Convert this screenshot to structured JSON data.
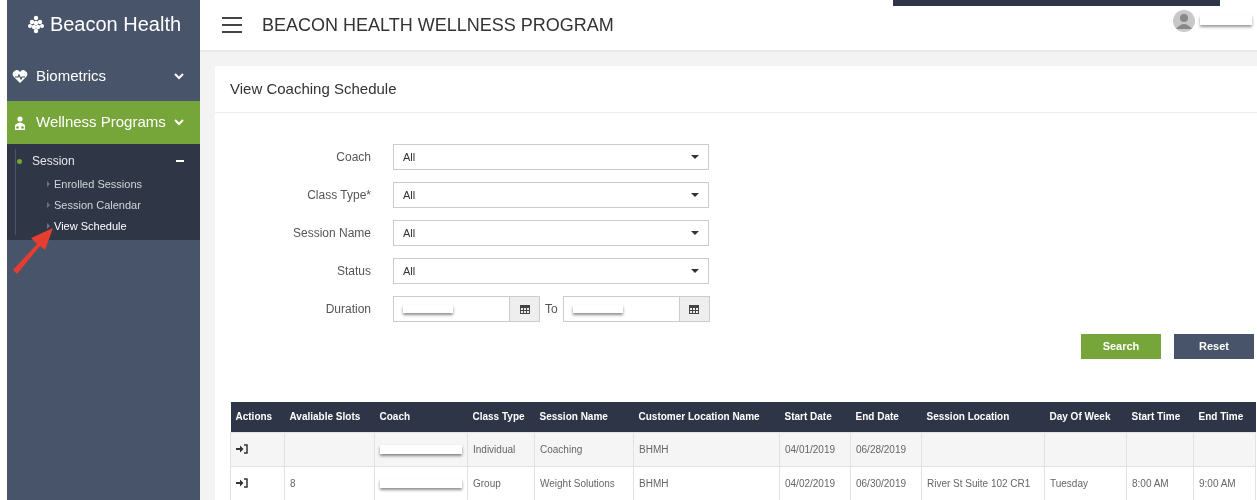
{
  "brand": {
    "name": "Beacon Health"
  },
  "sidebar": {
    "items": [
      {
        "label": "Biometrics",
        "selected": false
      },
      {
        "label": "Wellness Programs",
        "selected": true,
        "children": [
          {
            "label": "Session",
            "expanded": true,
            "children": [
              {
                "label": "Enrolled Sessions",
                "selected": false
              },
              {
                "label": "Session Calendar",
                "selected": false
              },
              {
                "label": "View Schedule",
                "selected": true
              }
            ]
          }
        ]
      }
    ]
  },
  "header": {
    "title": "BEACON HEALTH WELLNESS PROGRAM"
  },
  "card": {
    "title": "View Coaching Schedule",
    "form": [
      {
        "kind": "select",
        "label": "Coach",
        "value": "All"
      },
      {
        "kind": "select",
        "label": "Class Type*",
        "value": "All"
      },
      {
        "kind": "select",
        "label": "Session Name",
        "value": "All"
      },
      {
        "kind": "select",
        "label": "Status",
        "value": "All"
      },
      {
        "kind": "date_range",
        "label": "Duration",
        "separator": "To"
      }
    ],
    "buttons": [
      {
        "label": "Search",
        "kind": "primary"
      },
      {
        "label": "Reset",
        "kind": "secondary"
      }
    ],
    "table": {
      "columns": [
        "Actions",
        "Avaliable Slots",
        "Coach",
        "Class Type",
        "Session Name",
        "Customer Location Name",
        "Start Date",
        "End Date",
        "Session Location",
        "Day Of Week",
        "Start Time",
        "End Time"
      ],
      "rows": [
        [
          {
            "kind": "action"
          },
          {
            "kind": "empty"
          },
          {
            "kind": "redacted"
          },
          "Individual",
          "Coaching",
          "BHMH",
          "04/01/2019",
          "06/28/2019",
          {
            "kind": "empty"
          },
          {
            "kind": "empty"
          },
          {
            "kind": "empty"
          },
          {
            "kind": "empty"
          }
        ],
        [
          {
            "kind": "action"
          },
          "8",
          {
            "kind": "redacted"
          },
          "Group",
          "Weight Solutions",
          "BHMH",
          "04/02/2019",
          "06/30/2019",
          "River St Suite 102 CR1",
          "Tuesday",
          "8:00 AM",
          "9:00 AM"
        ]
      ]
    }
  }
}
